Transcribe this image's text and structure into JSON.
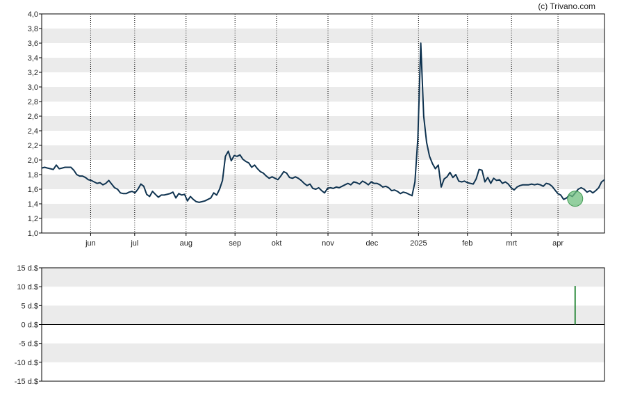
{
  "credit": "(c) Trivano.com",
  "colors": {
    "line": "#0f3350",
    "band": "#ebebeb",
    "frame": "#000000",
    "vgrid": "#000000",
    "marker_fill": "#6fbf7f",
    "marker_stroke": "#3f9a52",
    "volume": "#2e8b3e"
  },
  "chart_data": [
    {
      "type": "line",
      "title": "",
      "xlabel": "",
      "ylabel": "",
      "ylim": [
        1.0,
        4.0
      ],
      "grid": "alternating horizontal bands, dotted vertical month lines",
      "yticks": [
        "1,0",
        "1,2",
        "1,4",
        "1,6",
        "1,8",
        "2,0",
        "2,2",
        "2,4",
        "2,6",
        "2,8",
        "3,0",
        "3,2",
        "3,4",
        "3,6",
        "3,8",
        "4,0"
      ],
      "x_unit": "trading day index",
      "xlim": [
        0,
        230
      ],
      "months": [
        {
          "label": "jun",
          "x": 20
        },
        {
          "label": "jul",
          "x": 38
        },
        {
          "label": "aug",
          "x": 59
        },
        {
          "label": "sep",
          "x": 79
        },
        {
          "label": "okt",
          "x": 96
        },
        {
          "label": "nov",
          "x": 117
        },
        {
          "label": "dec",
          "x": 135
        },
        {
          "label": "2025",
          "x": 154
        },
        {
          "label": "feb",
          "x": 174
        },
        {
          "label": "mrt",
          "x": 192
        },
        {
          "label": "apr",
          "x": 211
        }
      ],
      "series": [
        {
          "values": [
            1.89,
            1.9,
            1.89,
            1.88,
            1.87,
            1.93,
            1.88,
            1.89,
            1.9,
            1.9,
            1.9,
            1.86,
            1.8,
            1.78,
            1.78,
            1.76,
            1.73,
            1.72,
            1.7,
            1.68,
            1.69,
            1.66,
            1.68,
            1.72,
            1.67,
            1.62,
            1.6,
            1.55,
            1.54,
            1.54,
            1.56,
            1.57,
            1.55,
            1.6,
            1.67,
            1.64,
            1.53,
            1.5,
            1.57,
            1.53,
            1.49,
            1.52,
            1.52,
            1.53,
            1.54,
            1.56,
            1.48,
            1.54,
            1.52,
            1.53,
            1.44,
            1.5,
            1.46,
            1.43,
            1.42,
            1.43,
            1.44,
            1.46,
            1.48,
            1.55,
            1.52,
            1.6,
            1.72,
            2.05,
            2.12,
            1.99,
            2.06,
            2.05,
            2.07,
            2.01,
            1.98,
            1.96,
            1.9,
            1.93,
            1.88,
            1.84,
            1.82,
            1.78,
            1.75,
            1.77,
            1.75,
            1.73,
            1.78,
            1.84,
            1.82,
            1.76,
            1.75,
            1.77,
            1.75,
            1.72,
            1.68,
            1.65,
            1.67,
            1.61,
            1.6,
            1.62,
            1.58,
            1.55,
            1.61,
            1.62,
            1.61,
            1.63,
            1.62,
            1.64,
            1.66,
            1.68,
            1.66,
            1.7,
            1.69,
            1.67,
            1.71,
            1.69,
            1.66,
            1.7,
            1.68,
            1.68,
            1.66,
            1.63,
            1.64,
            1.62,
            1.58,
            1.59,
            1.57,
            1.54,
            1.56,
            1.55,
            1.53,
            1.51,
            1.7,
            2.3,
            3.6,
            2.6,
            2.24,
            2.05,
            1.95,
            1.88,
            1.93,
            1.63,
            1.74,
            1.77,
            1.83,
            1.76,
            1.8,
            1.71,
            1.7,
            1.71,
            1.69,
            1.68,
            1.67,
            1.74,
            1.87,
            1.86,
            1.7,
            1.76,
            1.68,
            1.75,
            1.72,
            1.73,
            1.68,
            1.7,
            1.67,
            1.62,
            1.59,
            1.63,
            1.65,
            1.66,
            1.66,
            1.66,
            1.67,
            1.66,
            1.67,
            1.66,
            1.64,
            1.68,
            1.67,
            1.64,
            1.59,
            1.54,
            1.52,
            1.46,
            1.48,
            1.52,
            1.5,
            1.55,
            1.6,
            1.62,
            1.6,
            1.56,
            1.58,
            1.55,
            1.58,
            1.62,
            1.7,
            1.73
          ]
        }
      ],
      "marker": {
        "x": 218,
        "y": 1.47
      }
    },
    {
      "type": "bar",
      "title": "",
      "xlabel": "",
      "ylabel": "",
      "ylim": [
        -15,
        15
      ],
      "yticks": [
        "15 d.$",
        "10 d.$",
        "5 d.$",
        "0 d.$",
        "-5 d.$",
        "-10 d.$",
        "-15 d.$"
      ],
      "x_unit": "trading day index",
      "xlim": [
        0,
        230
      ],
      "bars": [
        {
          "x": 218,
          "value": 10.2
        }
      ]
    }
  ]
}
